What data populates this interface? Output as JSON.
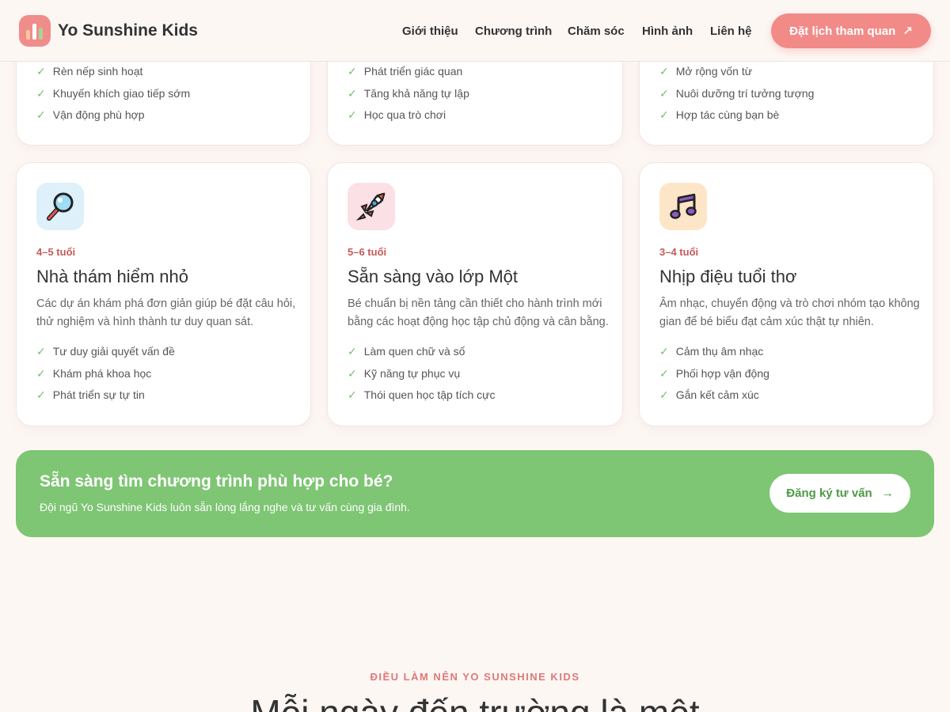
{
  "header": {
    "brand": "Yo Sunshine Kids",
    "nav": [
      "Giới thiệu",
      "Chương trình",
      "Chăm sóc",
      "Hình ảnh",
      "Liên hệ"
    ],
    "cta_label": "Đặt lịch tham quan",
    "cta_arrow": "↗"
  },
  "top_cards": [
    {
      "items": [
        "Rèn nếp sinh hoạt",
        "Khuyến khích giao tiếp sớm",
        "Vận động phù hợp"
      ]
    },
    {
      "items": [
        "Phát triển giác quan",
        "Tăng khả năng tự lập",
        "Học qua trò chơi"
      ]
    },
    {
      "items": [
        "Mở rộng vốn từ",
        "Nuôi dưỡng trí tưởng tượng",
        "Hợp tác cùng bạn bè"
      ]
    }
  ],
  "cards": [
    {
      "icon": "magnifier-icon",
      "age": "4–5 tuổi",
      "title": "Nhà thám hiểm nhỏ",
      "desc": "Các dự án khám phá đơn giản giúp bé đặt câu hỏi, thử nghiệm và hình thành tư duy quan sát.",
      "items": [
        "Tư duy giải quyết vấn đề",
        "Khám phá khoa học",
        "Phát triển sự tự tin"
      ]
    },
    {
      "icon": "rocket-icon",
      "age": "5–6 tuổi",
      "title": "Sẵn sàng vào lớp Một",
      "desc": "Bé chuẩn bị nền tảng cần thiết cho hành trình mới bằng các hoạt động học tập chủ động và cân bằng.",
      "items": [
        "Làm quen chữ và số",
        "Kỹ năng tự phục vụ",
        "Thói quen học tập tích cực"
      ]
    },
    {
      "icon": "music-note-icon",
      "age": "3–4 tuổi",
      "title": "Nhịp điệu tuổi thơ",
      "desc": "Âm nhạc, chuyển động và trò chơi nhóm tạo không gian để bé biểu đạt cảm xúc thật tự nhiên.",
      "items": [
        "Cảm thụ âm nhạc",
        "Phối hợp vận động",
        "Gắn kết cảm xúc"
      ]
    }
  ],
  "check_symbol": "✓",
  "banner": {
    "title": "Sẵn sàng tìm chương trình phù hợp cho bé?",
    "subtitle": "Đội ngũ Yo Sunshine Kids luôn sẵn lòng lắng nghe và tư vấn cùng gia đình.",
    "button_label": "Đăng ký tư vấn",
    "button_arrow": "→"
  },
  "section": {
    "eyebrow": "ĐIỀU LÀM NÊN YO SUNSHINE KIDS",
    "heading": "Mỗi ngày đến trường là một"
  },
  "colors": {
    "accent": "#f28a88",
    "green": "#7ec574",
    "background": "#fdf7f4"
  }
}
